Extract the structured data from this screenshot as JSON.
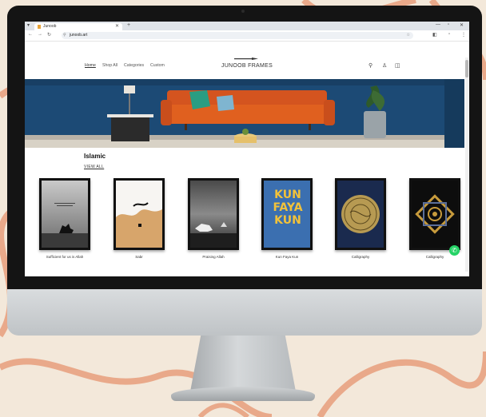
{
  "browser": {
    "tab_title": "Junoob",
    "tab_close": "✕",
    "new_tab": "+",
    "url": "junoob.art",
    "back": "←",
    "forward": "→",
    "reload": "↻"
  },
  "site": {
    "nav": [
      "Home",
      "Shop All",
      "Categories",
      "Custom"
    ],
    "logo": "JUNOOB FRAMES"
  },
  "section": {
    "heading": "Islamic",
    "view_all": "VIEW ALL"
  },
  "products": [
    {
      "name": "Sufficient for us is Allah"
    },
    {
      "name": "Sabr"
    },
    {
      "name": "Praising Allah"
    },
    {
      "name": "Kun Faya Kun"
    },
    {
      "name": "Calligraphy"
    },
    {
      "name": "Calligraphy"
    }
  ],
  "kun_art": {
    "line1": "KUN",
    "line2": "FAYA",
    "line3": "KUN"
  },
  "icons": {
    "search": "search-icon",
    "account": "account-icon",
    "cart": "cart-icon",
    "whatsapp": "whatsapp-icon"
  }
}
